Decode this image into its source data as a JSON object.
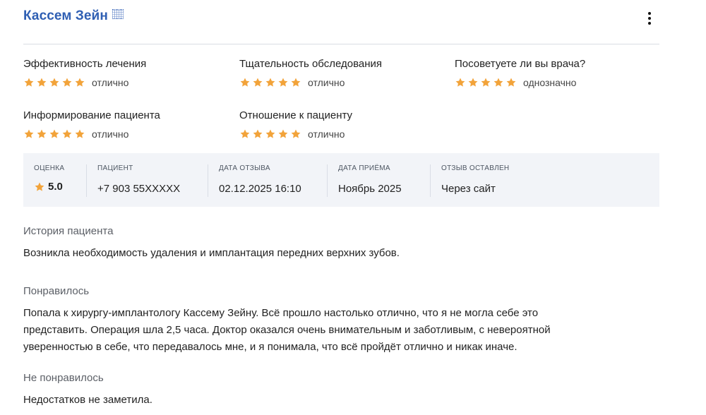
{
  "review": {
    "doctor_name": "Кассем Зейн",
    "badge_icon": "doctor-badge-icon",
    "menu_icon": "more-vertical-icon",
    "ratings": [
      {
        "title": "Эффективность лечения",
        "stars": 5,
        "label": "отлично"
      },
      {
        "title": "Тщательность обследования",
        "stars": 5,
        "label": "отлично"
      },
      {
        "title": "Посоветуете ли вы врача?",
        "stars": 5,
        "label": "однозначно"
      },
      {
        "title": "Информирование пациента",
        "stars": 5,
        "label": "отлично"
      },
      {
        "title": "Отношение к пациенту",
        "stars": 5,
        "label": "отлично"
      }
    ],
    "meta": {
      "score": {
        "label": "оценка",
        "value": "5.0"
      },
      "patient": {
        "label": "пациент",
        "value": "+7 903 55XXXXX"
      },
      "review_date": {
        "label": "дата отзыва",
        "value": "02.12.2025 16:10"
      },
      "visit_date": {
        "label": "дата приёма",
        "value": "Ноябрь 2025"
      },
      "source": {
        "label": "отзыв оставлен",
        "value": "Через сайт"
      }
    },
    "sections": {
      "history": {
        "title": "История пациента",
        "text": "Возникла необходимость удаления и имплантация передних верхних зубов."
      },
      "liked": {
        "title": "Понравилось",
        "text": "Попала к хирургу-имплантологу Кассему Зейну. Всё прошло настолько отлично, что я не могла себе это\nпредставить. Операция шла 2,5 часа. Доктор оказался очень внимательным и заботливым, с невероятной\nуверенностью в себе, что передавалось мне, и я понимала, что всё пройдёт отлично и никак иначе."
      },
      "disliked": {
        "title": "Не понравилось",
        "text": "Недостатков не заметила."
      }
    },
    "colors": {
      "name": "#2f5fb3",
      "star": "#f2a33a",
      "panel": "#f2f4f8",
      "divider": "#d9dde3"
    }
  }
}
